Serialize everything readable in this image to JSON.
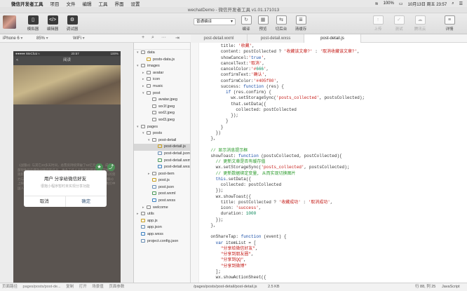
{
  "menubar": {
    "app": "微信开发者工具",
    "items": [
      "项目",
      "文件",
      "编辑",
      "工具",
      "界面",
      "设置"
    ],
    "battery": "100%",
    "clock": "10月13日 周五  23:57"
  },
  "window": {
    "title": "wechatDemo - 微信开发者工具 v1.01.171013"
  },
  "toolbar": {
    "simulator": "模拟器",
    "editor": "编辑器",
    "debugger": "调试器",
    "mode": "普通编译",
    "compile": "编译",
    "preview": "预览",
    "cut_back": "切后台",
    "clear_cache": "清缓存",
    "upload": "上传",
    "test": "测试",
    "tencent_cloud": "腾讯云",
    "details": "详情"
  },
  "simbar": {
    "device": "iPhone 6",
    "zoom": "85%",
    "network": "WiFi"
  },
  "tabs": [
    "post-detail.wxml",
    "post-detail.wxss",
    "post-detail.js"
  ],
  "phone": {
    "status_left": "●●●●● WeChat ≈",
    "status_time": "20:57",
    "status_right": "100%",
    "nav_back": "<",
    "nav_title": "阅读",
    "text": "《战狼2》与其它20多天时间，总票房持续突破了53亿元大关，成为一部现象级的爆款战狼电影作品，更多工作人员和演员都表示非常感谢。观影量也已经突破了大片的票房。这部作品的成功离不开吴京团队的努力与坚持，也离不开观众们的支持和热爱。\n\n上月29日开播的《战狼2》上映，我环和你，已经一个月的时间了……吴京说，战狼是属于我们中国人的……",
    "dialog": {
      "title": "用户 分享给微信好友",
      "message": "很抱小程序暂时未实现分享功能",
      "cancel": "取消",
      "ok": "确定"
    }
  },
  "sim_footer": [
    "页面路径",
    "pages/posts/post-de...",
    "复制",
    "打开",
    "场景值",
    "页面参数"
  ],
  "tree": [
    {
      "label": "data",
      "depth": 1,
      "type": "folder",
      "open": true
    },
    {
      "label": "posts-data.js",
      "depth": 2,
      "type": "js"
    },
    {
      "label": "images",
      "depth": 1,
      "type": "folder",
      "open": true
    },
    {
      "label": "avatar",
      "depth": 2,
      "type": "folder"
    },
    {
      "label": "icon",
      "depth": 2,
      "type": "folder"
    },
    {
      "label": "music",
      "depth": 2,
      "type": "folder"
    },
    {
      "label": "post",
      "depth": 2,
      "type": "folder",
      "open": true
    },
    {
      "label": "avatar.jpeg",
      "depth": 3,
      "type": "img"
    },
    {
      "label": "wx1f.jpeg",
      "depth": 3,
      "type": "img"
    },
    {
      "label": "wxl2.jpeg",
      "depth": 3,
      "type": "img"
    },
    {
      "label": "wxl3.jpeg",
      "depth": 3,
      "type": "img"
    },
    {
      "label": "pages",
      "depth": 1,
      "type": "folder",
      "open": true
    },
    {
      "label": "posts",
      "depth": 2,
      "type": "folder",
      "open": true
    },
    {
      "label": "post-detail",
      "depth": 3,
      "type": "folder",
      "open": true
    },
    {
      "label": "post-detail.js",
      "depth": 4,
      "type": "js",
      "selected": true
    },
    {
      "label": "post-detail.json",
      "depth": 4,
      "type": "json"
    },
    {
      "label": "post-detail.wxml",
      "depth": 4,
      "type": "wxml"
    },
    {
      "label": "post-detail.wxss",
      "depth": 4,
      "type": "wxss"
    },
    {
      "label": "post-item",
      "depth": 3,
      "type": "folder"
    },
    {
      "label": "post.js",
      "depth": 3,
      "type": "js"
    },
    {
      "label": "post.json",
      "depth": 3,
      "type": "json"
    },
    {
      "label": "post.wxml",
      "depth": 3,
      "type": "wxml"
    },
    {
      "label": "post.wxss",
      "depth": 3,
      "type": "wxss"
    },
    {
      "label": "welcome",
      "depth": 2,
      "type": "folder"
    },
    {
      "label": "utils",
      "depth": 1,
      "type": "folder"
    },
    {
      "label": "app.js",
      "depth": 1,
      "type": "js"
    },
    {
      "label": "app.json",
      "depth": 1,
      "type": "json"
    },
    {
      "label": "app.wxss",
      "depth": 1,
      "type": "wxss"
    },
    {
      "label": "project.config.json",
      "depth": 1,
      "type": "json"
    }
  ],
  "code_lines": [
    "        title: '收藏',",
    "        content: postCollected ? '收藏该文章?' : '取消收藏该文章?',",
    "        showCancel:'true',",
    "        cancelText:'取消',",
    "        cancelColor:'#666',",
    "        confirmText:'确认',",
    "        confirmColor:'#405f80',",
    "        success: function (res) {",
    "          if (res.confirm) {",
    "            wx.setStorageSync('posts_collected', postsCollected);",
    "            that.setData({",
    "              collected: postCollected",
    "            });",
    "          }",
    "        }",
    "      })",
    "    },",
    "",
    "    // 显示消息提示框",
    "    showToast: function (postsCollected, postCollected){",
    "      // 更新文章是否有缓存值",
    "      wx.setStorageSync('posts_collected', postsCollected);",
    "      // 更新数据绑定变量, 从而实现切换图片",
    "      this.setData({",
    "        collected: postCollected",
    "      });",
    "      wx.showToast({",
    "        title: postCollected ? '收藏成功' : '取消成功',",
    "        icon: 'success',",
    "        duration: 1000",
    "      });",
    "    },",
    "",
    "    onShareTap: function (event) {",
    "      var itemList = [",
    "        \"分享给微信好友\",",
    "        \"分享到朋友圈\",",
    "        \"分享到QQ\",",
    "        \"分享到微博\"",
    "      ];",
    "      wx.showActionSheet({"
  ],
  "editor_footer": {
    "path": "/pages/posts/post-detail/post-detail.js",
    "size": "2.5 KB",
    "position": "行 88, 列 25",
    "language": "JavaScript"
  }
}
